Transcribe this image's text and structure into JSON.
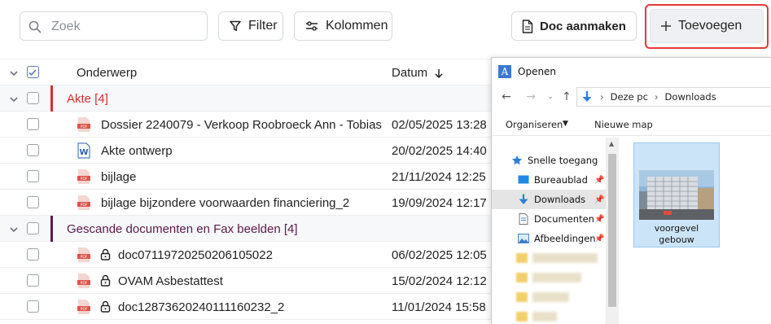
{
  "toolbar": {
    "search_placeholder": "Zoek",
    "filter_label": "Filter",
    "columns_label": "Kolommen",
    "create_doc_label": "Doc aanmaken",
    "add_label": "Toevoegen"
  },
  "table": {
    "col_subject": "Onderwerp",
    "col_date": "Datum",
    "groups": [
      {
        "label": "Akte [4]",
        "color": "#d32f2f",
        "rows": [
          {
            "name": "Dossier 2240079 - Verkoop Roobroeck Ann - Tobias",
            "date": "02/05/2025 13:28",
            "icon": "pdf-icon"
          },
          {
            "name": "Akte ontwerp",
            "date": "20/02/2025 14:40",
            "icon": "word-icon"
          },
          {
            "name": "bijlage",
            "date": "21/11/2024 12:25",
            "icon": "pdf-icon"
          },
          {
            "name": "bijlage bijzondere voorwaarden financiering_2",
            "date": "19/09/2024 12:17",
            "icon": "pdf-icon"
          }
        ]
      },
      {
        "label": "Gescande documenten en Fax beelden [4]",
        "color": "#5b1a4a",
        "rows": [
          {
            "name": "doc07119720250206105022",
            "date": "06/02/2025 12:05",
            "icon": "pdf-icon",
            "locked": true
          },
          {
            "name": "OVAM Asbestattest",
            "date": "15/02/2024 12:12",
            "icon": "pdf-icon",
            "locked": true
          },
          {
            "name": "doc12873620240111160232_2",
            "date": "11/01/2024 15:58",
            "icon": "pdf-icon",
            "locked": true
          }
        ]
      }
    ]
  },
  "dialog": {
    "title": "Openen",
    "app_icon_letter": "A",
    "path": [
      "Deze pc",
      "Downloads"
    ],
    "organize_label": "Organiseren",
    "new_folder_label": "Nieuwe map",
    "nav": {
      "quick_access": "Snelle toegang",
      "desktop": "Bureaublad",
      "downloads": "Downloads",
      "documents": "Documenten",
      "pictures": "Afbeeldingen"
    },
    "file": {
      "name_line1": "voorgevel",
      "name_line2": "gebouw"
    }
  }
}
